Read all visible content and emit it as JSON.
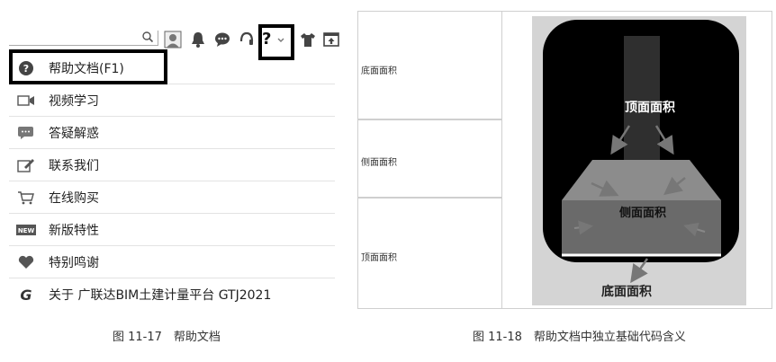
{
  "toolbar": {
    "icons": [
      "search-icon",
      "avatar-icon",
      "bell-icon",
      "chat-icon",
      "headset-icon",
      "help-icon",
      "chevron-down-icon",
      "shirt-icon",
      "upload-window-icon"
    ],
    "help_label": "?"
  },
  "menu": {
    "items": [
      {
        "icon": "question-circle-icon",
        "label": "帮助文档(F1)"
      },
      {
        "icon": "video-icon",
        "label": "视频学习"
      },
      {
        "icon": "chat-bubble-icon",
        "label": "答疑解惑"
      },
      {
        "icon": "edit-icon",
        "label": "联系我们"
      },
      {
        "icon": "cart-icon",
        "label": "在线购买"
      },
      {
        "icon": "new-badge-icon",
        "label": "新版特性"
      },
      {
        "icon": "heart-icon",
        "label": "特别鸣谢"
      },
      {
        "icon": "g-logo-icon",
        "label": "关于 广联达BIM土建计量平台 GTJ2021"
      }
    ]
  },
  "captions": {
    "left": "图 11-17　帮助文档",
    "right": "图 11-18　帮助文档中独立基础代码含义"
  },
  "table": {
    "rows": [
      "底面面积",
      "侧面面积",
      "顶面面积"
    ]
  },
  "figure": {
    "top_label": "顶面面积",
    "side_label": "侧面面积",
    "bottom_label": "底面面积"
  }
}
